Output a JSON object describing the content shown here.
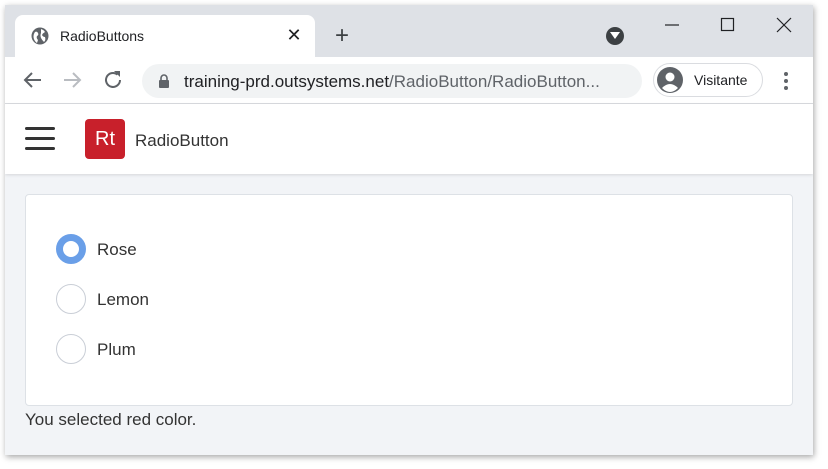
{
  "browser": {
    "tab_title": "RadioButtons",
    "new_tab_symbol": "+",
    "close_symbol": "✕",
    "url_domain": "training-prd.outsystems.net",
    "url_path": "/RadioButton/RadioButton...",
    "profile_name": "Visitante"
  },
  "header": {
    "logo_text": "Rt",
    "app_title": "RadioButton",
    "logo_color": "#c8202b"
  },
  "radio_group": {
    "options": [
      {
        "label": "Rose",
        "checked": true
      },
      {
        "label": "Lemon",
        "checked": false
      },
      {
        "label": "Plum",
        "checked": false
      }
    ],
    "accent": "#6a9fe8"
  },
  "result_message": "You selected red color."
}
